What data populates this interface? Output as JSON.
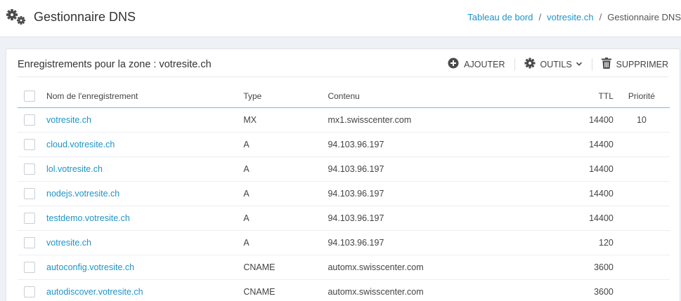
{
  "header": {
    "title": "Gestionnaire DNS",
    "breadcrumb": [
      "Tableau de bord",
      "votresite.ch",
      "Gestionnaire DNS"
    ],
    "breadcrumb_separator": "/"
  },
  "zone": {
    "title": "Enregistrements pour la zone : votresite.ch",
    "actions": {
      "add_label": "AJOUTER",
      "tools_label": "OUTILS",
      "delete_label": "SUPPRIMER"
    }
  },
  "table": {
    "columns": [
      "Nom de l'enregistrement",
      "Type",
      "Contenu",
      "TTL",
      "Priorité"
    ],
    "rows": [
      {
        "name": "votresite.ch",
        "type": "MX",
        "content": "mx1.swisscenter.com",
        "ttl": "14400",
        "priority": "10"
      },
      {
        "name": "cloud.votresite.ch",
        "type": "A",
        "content": "94.103.96.197",
        "ttl": "14400",
        "priority": ""
      },
      {
        "name": "lol.votresite.ch",
        "type": "A",
        "content": "94.103.96.197",
        "ttl": "14400",
        "priority": ""
      },
      {
        "name": "nodejs.votresite.ch",
        "type": "A",
        "content": "94.103.96.197",
        "ttl": "14400",
        "priority": ""
      },
      {
        "name": "testdemo.votresite.ch",
        "type": "A",
        "content": "94.103.96.197",
        "ttl": "14400",
        "priority": ""
      },
      {
        "name": "votresite.ch",
        "type": "A",
        "content": "94.103.96.197",
        "ttl": "120",
        "priority": ""
      },
      {
        "name": "autoconfig.votresite.ch",
        "type": "CNAME",
        "content": "automx.swisscenter.com",
        "ttl": "3600",
        "priority": ""
      },
      {
        "name": "autodiscover.votresite.ch",
        "type": "CNAME",
        "content": "automx.swisscenter.com",
        "ttl": "3600",
        "priority": ""
      }
    ]
  },
  "colors": {
    "link": "#1d94c9",
    "page_bg": "#eef1f5",
    "header_rule": "#7fb9d8"
  },
  "icons": {
    "title": "gears-icon",
    "add": "plus-circle-icon",
    "tools": "gear-icon",
    "tools_caret": "chevron-down-icon",
    "delete": "trash-icon"
  }
}
